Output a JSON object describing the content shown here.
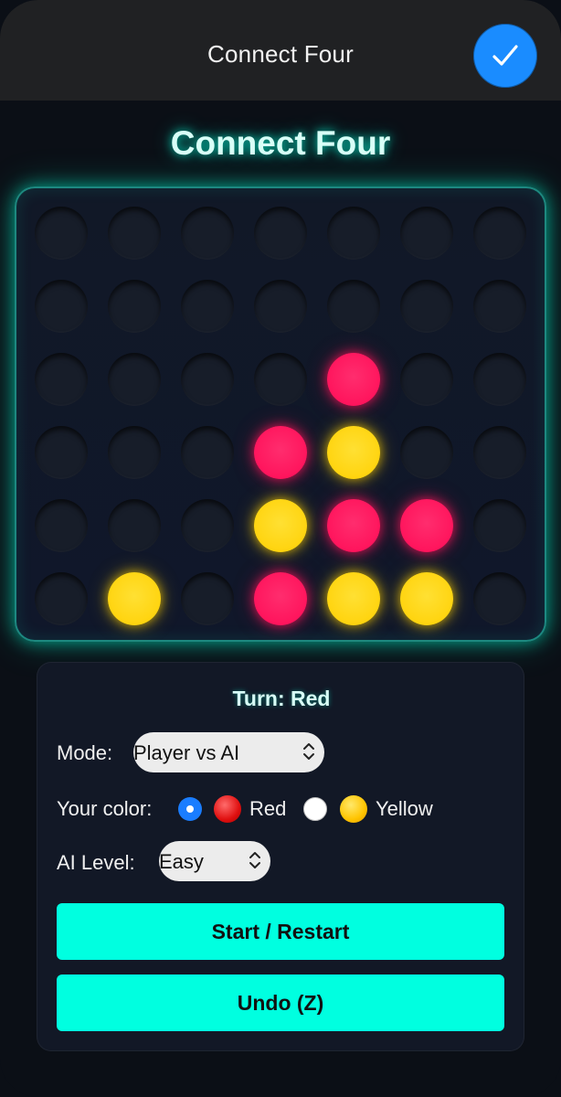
{
  "topbar": {
    "title": "Connect Four",
    "done_icon": "checkmark-icon"
  },
  "game": {
    "title": "Connect Four",
    "rows": 6,
    "cols": 7,
    "board": [
      [
        ".",
        ".",
        ".",
        ".",
        ".",
        ".",
        "."
      ],
      [
        ".",
        ".",
        ".",
        ".",
        ".",
        ".",
        "."
      ],
      [
        ".",
        ".",
        ".",
        ".",
        "R",
        ".",
        "."
      ],
      [
        ".",
        ".",
        ".",
        "R",
        "Y",
        ".",
        "."
      ],
      [
        ".",
        ".",
        ".",
        "Y",
        "R",
        "R",
        "."
      ],
      [
        ".",
        "Y",
        ".",
        "R",
        "Y",
        "Y",
        "."
      ]
    ],
    "colors": {
      "red": "#ff1060",
      "yellow": "#ffd400",
      "accent": "#00ffe0"
    }
  },
  "panel": {
    "turn": "Turn: Red",
    "mode_label": "Mode:",
    "mode_value": "Player vs AI",
    "color_label": "Your color:",
    "color_red": "Red",
    "color_yellow": "Yellow",
    "color_selected": "Red",
    "ai_label": "AI Level:",
    "ai_value": "Easy",
    "start_label": "Start / Restart",
    "undo_label": "Undo (Z)"
  }
}
